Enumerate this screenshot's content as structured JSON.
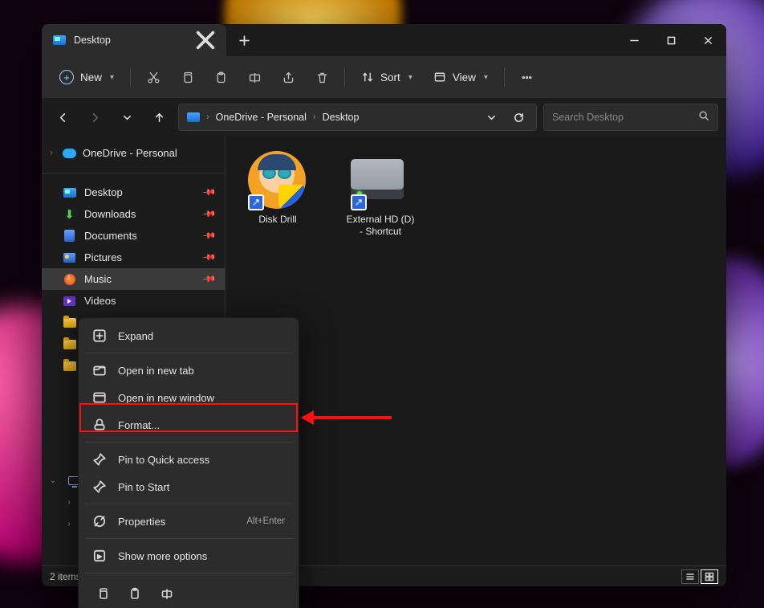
{
  "tab": {
    "title": "Desktop"
  },
  "toolbar": {
    "new_label": "New",
    "sort_label": "Sort",
    "view_label": "View"
  },
  "breadcrumbs": {
    "seg1": "OneDrive - Personal",
    "seg2": "Desktop"
  },
  "search": {
    "placeholder": "Search Desktop"
  },
  "sidebar": {
    "root": "OneDrive - Personal",
    "items": [
      {
        "label": "Desktop"
      },
      {
        "label": "Downloads"
      },
      {
        "label": "Documents"
      },
      {
        "label": "Pictures"
      },
      {
        "label": "Music"
      },
      {
        "label": "Videos"
      }
    ]
  },
  "files": [
    {
      "label": "Disk Drill"
    },
    {
      "label": "External HD (D) - Shortcut"
    }
  ],
  "context_menu": {
    "expand": "Expand",
    "open_tab": "Open in new tab",
    "open_window": "Open in new window",
    "format": "Format...",
    "pin_quick": "Pin to Quick access",
    "pin_start": "Pin to Start",
    "properties": "Properties",
    "properties_kbd": "Alt+Enter",
    "more": "Show more options"
  },
  "status": {
    "text": "2 items"
  }
}
